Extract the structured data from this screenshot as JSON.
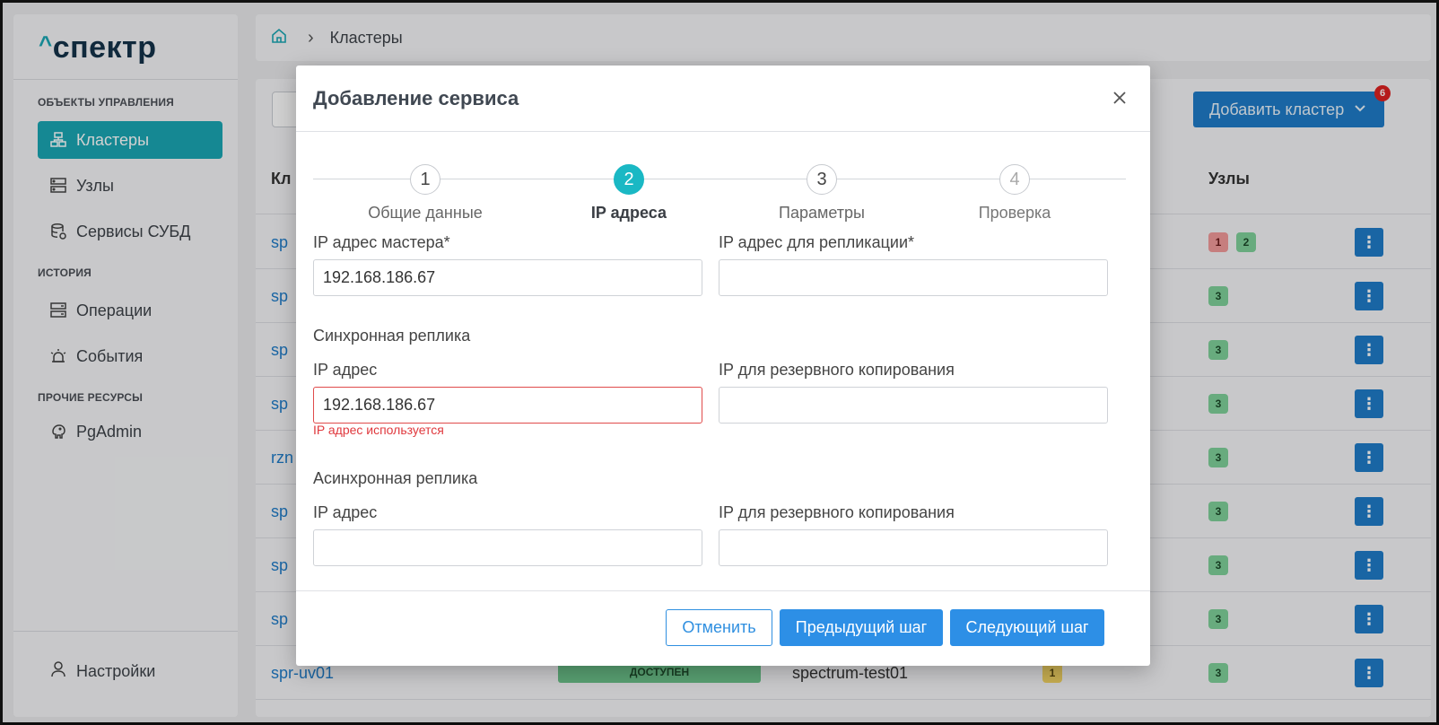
{
  "app": {
    "logo_text": "спектр",
    "logo_caret": "^"
  },
  "sidebar": {
    "sections": [
      {
        "title": "ОБЪЕКТЫ УПРАВЛЕНИЯ"
      },
      {
        "title": "ИСТОРИЯ"
      },
      {
        "title": "ПРОЧИЕ РЕСУРСЫ"
      }
    ],
    "items": [
      {
        "label": "Кластеры",
        "icon": "clusters-icon",
        "active": true
      },
      {
        "label": "Узлы",
        "icon": "servers-icon"
      },
      {
        "label": "Сервисы СУБД",
        "icon": "database-icon"
      },
      {
        "label": "Операции",
        "icon": "operations-icon"
      },
      {
        "label": "События",
        "icon": "alarm-icon"
      },
      {
        "label": "PgAdmin",
        "icon": "elephant-icon"
      }
    ],
    "settings_label": "Настройки"
  },
  "breadcrumb": {
    "current": "Кластеры"
  },
  "toolbar": {
    "add_cluster_label": "Добавить кластер",
    "notification_count": "6"
  },
  "table": {
    "headers": {
      "name": "Кл",
      "nodes": "Узлы"
    },
    "rows": [
      {
        "name": "sp",
        "badges": [
          {
            "v": "1",
            "c": "red"
          },
          {
            "v": "2",
            "c": "green"
          }
        ]
      },
      {
        "name": "sp",
        "badges": [
          {
            "v": "3",
            "c": "green"
          }
        ]
      },
      {
        "name": "sp",
        "badges": [
          {
            "v": "3",
            "c": "green"
          }
        ]
      },
      {
        "name": "sp",
        "badges": [
          {
            "v": "3",
            "c": "green"
          }
        ]
      },
      {
        "name": "rzn",
        "badges": [
          {
            "v": "3",
            "c": "green"
          }
        ]
      },
      {
        "name": "sp",
        "badges": [
          {
            "v": "3",
            "c": "green"
          }
        ]
      },
      {
        "name": "sp",
        "badges": [
          {
            "v": "3",
            "c": "green"
          }
        ]
      },
      {
        "name": "sp",
        "badges": [
          {
            "v": "3",
            "c": "green"
          }
        ]
      },
      {
        "name": "spr-uv01",
        "status": "ДОСТУПЕН",
        "host": "spectrum-test01",
        "service_badge": "1",
        "badges": [
          {
            "v": "3",
            "c": "green"
          }
        ]
      }
    ],
    "row_menu_glyph": "⋮"
  },
  "modal": {
    "title": "Добавление сервиса",
    "steps": [
      {
        "num": "1",
        "label": "Общие данные",
        "state": "done"
      },
      {
        "num": "2",
        "label": "IP адреса",
        "state": "active"
      },
      {
        "num": "3",
        "label": "Параметры",
        "state": "todo"
      },
      {
        "num": "4",
        "label": "Проверка",
        "state": "future"
      }
    ],
    "master_ip": {
      "label": "IP адрес мастера*",
      "value": "192.168.186.67"
    },
    "replication_ip": {
      "label": "IP адрес для репликации*",
      "value": ""
    },
    "sync_replica": {
      "section_title": "Синхронная реплика",
      "ip_label": "IP адрес",
      "ip_value": "192.168.186.67",
      "ip_error": "IP адрес используется",
      "backup_label": "IP для резервного копирования",
      "backup_value": ""
    },
    "async_replica": {
      "section_title": "Асинхронная реплика",
      "ip_label": "IP адрес",
      "ip_value": "",
      "backup_label": "IP для резервного копирования",
      "backup_value": ""
    },
    "buttons": {
      "cancel": "Отменить",
      "prev": "Предыдущий шаг",
      "next": "Следующий шаг"
    }
  },
  "colors": {
    "accent": "#1aa7b4",
    "primary": "#2d8fe6",
    "error": "#e0393e"
  }
}
